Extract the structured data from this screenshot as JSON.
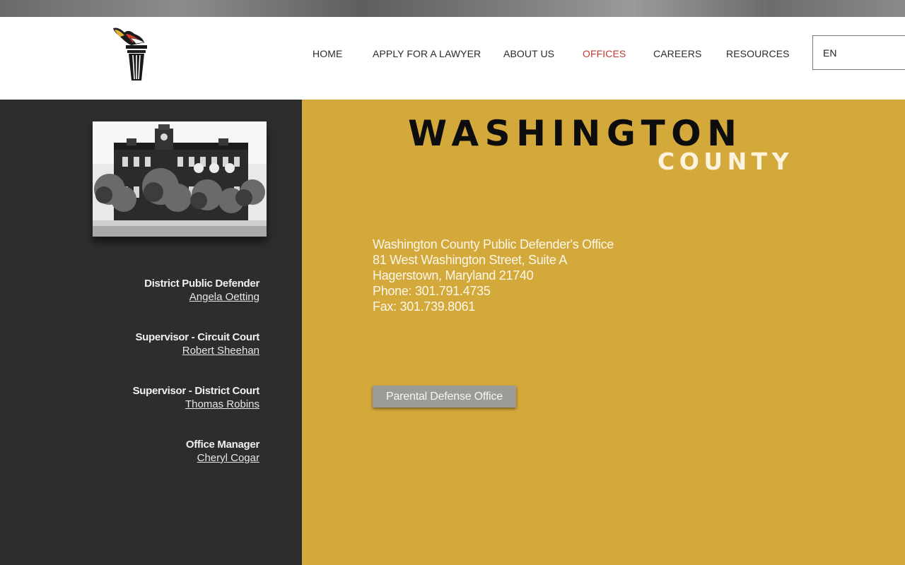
{
  "header": {
    "logo_icon": "torch-logo-icon",
    "nav": [
      {
        "label": "HOME",
        "active": false
      },
      {
        "label": "APPLY FOR A LAWYER",
        "active": false
      },
      {
        "label": "ABOUT US",
        "active": false
      },
      {
        "label": "OFFICES",
        "active": true
      },
      {
        "label": "CAREERS",
        "active": false
      },
      {
        "label": "RESOURCES",
        "active": false
      }
    ],
    "language": "EN"
  },
  "sidebar": {
    "photo_icon": "courthouse-photo",
    "staff": [
      {
        "role": "District Public Defender",
        "name": "Angela Oetting"
      },
      {
        "role": "Supervisor - Circuit Court",
        "name": "Robert Sheehan"
      },
      {
        "role": "Supervisor - District Court",
        "name": "Thomas Robins"
      },
      {
        "role": "Office Manager",
        "name": "Cheryl Cogar"
      }
    ]
  },
  "main": {
    "title": "WASHINGTON",
    "subtitle": "COUNTY",
    "address_lines": [
      "Washington County Public Defender's Office",
      "81 West Washington Street, Suite A",
      "Hagerstown, Maryland 21740",
      "Phone: 301.791.4735",
      "Fax: 301.739.8061"
    ],
    "button_label": "Parental Defense Office"
  },
  "colors": {
    "gold": "#d4a93b",
    "dark": "#2d2d2d",
    "active_nav": "#c23a2b"
  }
}
